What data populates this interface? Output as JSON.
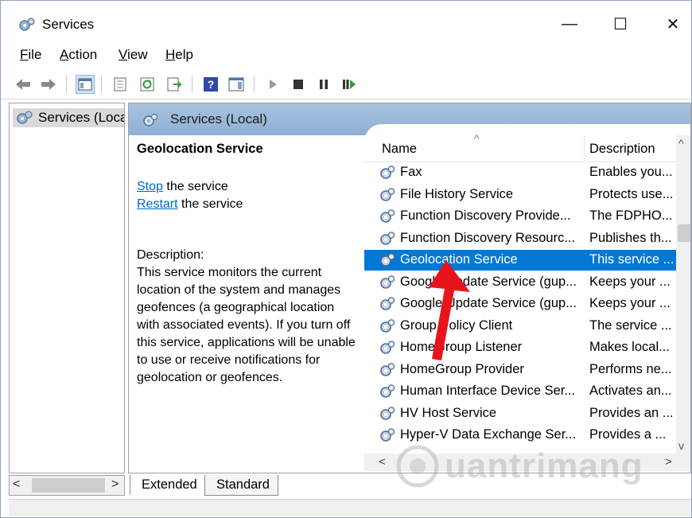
{
  "window": {
    "title": "Services",
    "controls": {
      "minimize": "—",
      "maximize": "☐",
      "close": "✕"
    }
  },
  "menu": [
    {
      "accel": "F",
      "rest": "ile"
    },
    {
      "accel": "A",
      "rest": "ction"
    },
    {
      "accel": "V",
      "rest": "iew"
    },
    {
      "accel": "H",
      "rest": "elp"
    }
  ],
  "toolbar": {
    "icons": [
      "back-arrow-icon",
      "forward-arrow-icon",
      "show-hide-console-tree-icon",
      "properties-icon",
      "refresh-icon",
      "export-list-icon",
      "help-icon",
      "action-pane-icon",
      "start-service-icon",
      "stop-service-icon",
      "pause-service-icon",
      "restart-service-icon"
    ]
  },
  "tree": {
    "label": "Services (Local)"
  },
  "pane": {
    "header": "Services (Local)"
  },
  "details": {
    "service_name": "Geolocation Service",
    "stop_link": "Stop",
    "stop_suffix": " the service",
    "restart_link": "Restart",
    "restart_suffix": " the service",
    "description_label": "Description:",
    "description_text": "This service monitors the current location of the system and manages geofences (a geographical location with associated events).  If you turn off this service, applications will be unable to use or receive notifications for geolocation or geofences."
  },
  "list": {
    "columns": {
      "name": "Name",
      "description": "Description"
    },
    "rows": [
      {
        "name": "Fax",
        "description": "Enables you..."
      },
      {
        "name": "File History Service",
        "description": "Protects use..."
      },
      {
        "name": "Function Discovery Provide...",
        "description": "The FDPHO..."
      },
      {
        "name": "Function Discovery Resourc...",
        "description": "Publishes th..."
      },
      {
        "name": "Geolocation Service",
        "description": "This service ...",
        "selected": true
      },
      {
        "name": "Google Update Service (gup...",
        "description": "Keeps your ..."
      },
      {
        "name": "Google Update Service (gup...",
        "description": "Keeps your ..."
      },
      {
        "name": "Group Policy Client",
        "description": "The service ..."
      },
      {
        "name": "HomeGroup Listener",
        "description": "Makes local..."
      },
      {
        "name": "HomeGroup Provider",
        "description": "Performs ne..."
      },
      {
        "name": "Human Interface Device Ser...",
        "description": "Activates an..."
      },
      {
        "name": "HV Host Service",
        "description": "Provides an ..."
      },
      {
        "name": "Hyper-V Data Exchange Ser...",
        "description": "Provides a ..."
      }
    ]
  },
  "tabs": {
    "extended": "Extended",
    "standard": "Standard"
  },
  "watermark": {
    "text": "uantrimang"
  },
  "colors": {
    "selection": "#0078d7",
    "link": "#0066cc",
    "arrow": "#e8141c",
    "header": "#9db9da"
  }
}
